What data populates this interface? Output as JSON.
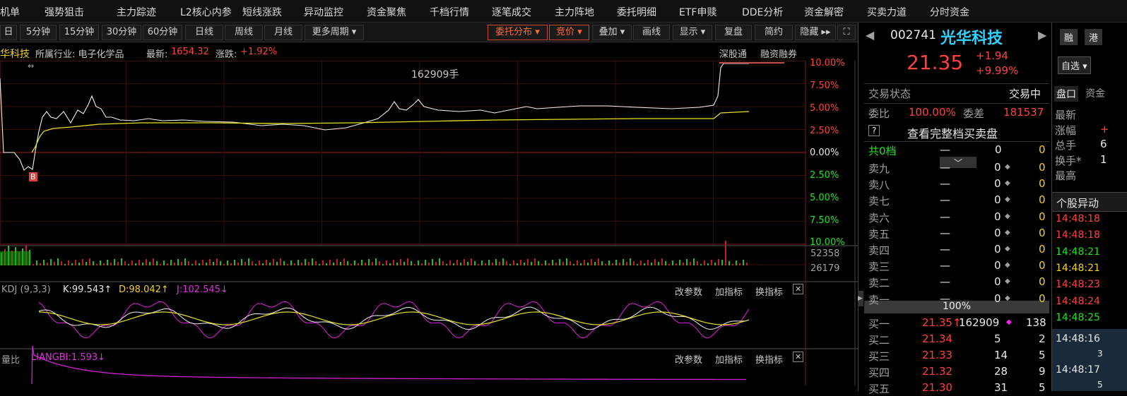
{
  "nav": [
    "机单",
    "强势狙击",
    "主力踪迹",
    "L2核心内参",
    "短线涨跌",
    "异动监控",
    "资金聚焦",
    "千档行情",
    "逐笔成交",
    "主力阵地",
    "委托明细",
    "ETF申赎",
    "DDE分析",
    "资金解密",
    "买卖力道",
    "分时资金"
  ],
  "toolbar": {
    "b0": "日",
    "b1": "5分钟",
    "b2": "15分钟",
    "b3": "30分钟",
    "b4": "60分钟",
    "b5": "日线",
    "b6": "周线",
    "b7": "月线",
    "b8": "更多周期 ▾",
    "b9": "委托分布 ▾",
    "b10": "竞价 ▾",
    "b11": "叠加 ▾",
    "b12": "画线",
    "b13": "显示 ▾",
    "b14": "复盘",
    "b15": "简约",
    "b16": "隐藏 ▸▸",
    "b17": "⛶"
  },
  "info": {
    "name": "华科技",
    "industry": "所属行业: 电子化学品",
    "latest_label": "最新:",
    "latest": "1654.32",
    "chg_label": "涨跌:",
    "chg": "+1.92%",
    "sgt": "深股通",
    "rzrq": "融资融券"
  },
  "chart": {
    "vol_marker": "162909手",
    "b_marker": "B",
    "pct_labels": [
      "10.00%",
      "7.50%",
      "5.00%",
      "2.50%",
      "0.00%",
      "2.50%",
      "5.00%",
      "7.50%",
      "10.00%"
    ],
    "vol_labels": [
      "52358",
      "26179"
    ],
    "kdj": {
      "label": "KDJ (9,3,3)",
      "k": "K:99.543↑",
      "d": "D:98.042↑",
      "j": "J:102.545↓",
      "a": "改参数",
      "b": "加指标",
      "c": "换指标",
      "x": "✕"
    },
    "lb": {
      "label": "量比",
      "v": "LIANGBI:1.593↓",
      "a": "改参数",
      "b": "加指标",
      "c": "换指标",
      "x": "✕"
    },
    "colors": {
      "price": "#f0f0f0",
      "avg": "#e8e020",
      "k": "#f0f0f0",
      "d": "#e8e020",
      "j": "#e020e0",
      "lb": "#d020d0"
    }
  },
  "stock": {
    "code": "002741",
    "name": "光华科技",
    "price": "21.35",
    "chg": "+1.94",
    "pct": "+9.99%",
    "rong": "融",
    "gang": "港",
    "zixuan": "自选 ▾"
  },
  "panel": {
    "status_label": "交易状态",
    "status": "交易中",
    "weibi_label": "委比",
    "weibi": "100.00%",
    "weicha_label": "委差",
    "weicha": "181537",
    "q": "?",
    "full": "查看完整档买卖盘",
    "gong": "共0档",
    "dash": "—",
    "z": "0",
    "ratio": "100%",
    "tabs": [
      "盘口",
      "资金"
    ],
    "fields": [
      "最新",
      "涨幅",
      "总手",
      "换手*",
      "最高"
    ],
    "fvals": [
      "",
      "+",
      "6",
      "1",
      ""
    ],
    "yidong": "个股异动"
  },
  "asks": [
    {
      "l": "卖九",
      "p": "—",
      "v": "0",
      "n": "0"
    },
    {
      "l": "卖八",
      "p": "—",
      "v": "0",
      "n": "0"
    },
    {
      "l": "卖七",
      "p": "—",
      "v": "0",
      "n": "0"
    },
    {
      "l": "卖六",
      "p": "—",
      "v": "0",
      "n": "0"
    },
    {
      "l": "卖五",
      "p": "—",
      "v": "0",
      "n": "0"
    },
    {
      "l": "卖四",
      "p": "—",
      "v": "0",
      "n": "0"
    },
    {
      "l": "卖三",
      "p": "—",
      "v": "0",
      "n": "0"
    },
    {
      "l": "卖二",
      "p": "—",
      "v": "0",
      "n": "0"
    },
    {
      "l": "卖一",
      "p": "—",
      "v": "0",
      "n": "0"
    }
  ],
  "bids": [
    {
      "l": "买一",
      "p": "21.35↑",
      "v": "162909",
      "n": "138"
    },
    {
      "l": "买二",
      "p": "21.34",
      "v": "5",
      "n": "2"
    },
    {
      "l": "买三",
      "p": "21.33",
      "v": "14",
      "n": "5"
    },
    {
      "l": "买四",
      "p": "21.32",
      "v": "28",
      "n": "9"
    },
    {
      "l": "买五",
      "p": "21.30",
      "v": "31",
      "n": "5"
    }
  ],
  "times": [
    {
      "t": "14:48:18",
      "c": "red"
    },
    {
      "t": "14:48:18",
      "c": "red"
    },
    {
      "t": "14:48:21",
      "c": "grn"
    },
    {
      "t": "14:48:21",
      "c": "yel"
    },
    {
      "t": "14:48:23",
      "c": "red"
    },
    {
      "t": "14:48:24",
      "c": "red"
    },
    {
      "t": "14:48:25",
      "c": "grn"
    }
  ],
  "times2": [
    "14:48:16",
    "3",
    "14:48:17",
    "5"
  ]
}
